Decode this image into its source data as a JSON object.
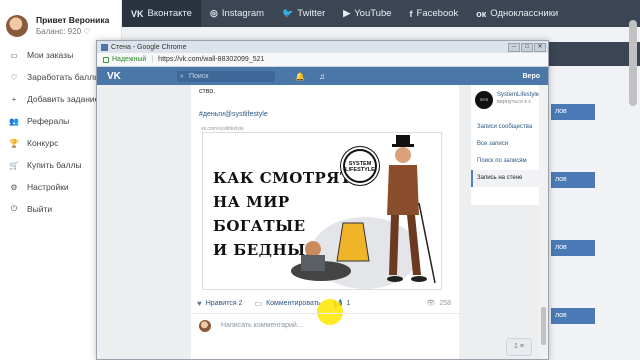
{
  "profile": {
    "name": "Привет Вероника",
    "balance": "Баланс: 920 ♡"
  },
  "menu": [
    {
      "icon": "cart-icon",
      "glyph": "▭",
      "label": "Мои заказы"
    },
    {
      "icon": "heart-icon",
      "glyph": "♡",
      "label": "Заработать баллы"
    },
    {
      "icon": "plus-icon",
      "glyph": "+",
      "label": "Добавить задание"
    },
    {
      "icon": "users-icon",
      "glyph": "👥",
      "label": "Рефералы"
    },
    {
      "icon": "trophy-icon",
      "glyph": "🏆",
      "label": "Конкурс"
    },
    {
      "icon": "cart-buy-icon",
      "glyph": "🛒",
      "label": "Купить баллы"
    },
    {
      "icon": "gear-icon",
      "glyph": "⚙",
      "label": "Настройки"
    },
    {
      "icon": "power-icon",
      "glyph": "⏻",
      "label": "Выйти"
    }
  ],
  "topnav": [
    {
      "icon": "vk-icon",
      "glyph": "VK",
      "label": "Вконтакте",
      "active": true
    },
    {
      "icon": "instagram-icon",
      "glyph": "◎",
      "label": "Instagram",
      "active": false
    },
    {
      "icon": "twitter-icon",
      "glyph": "🐦",
      "label": "Twitter",
      "active": false
    },
    {
      "icon": "youtube-icon",
      "glyph": "▶",
      "label": "YouTube",
      "active": false
    },
    {
      "icon": "facebook-icon",
      "glyph": "f",
      "label": "Facebook",
      "active": false
    },
    {
      "icon": "odnoklassniki-icon",
      "glyph": "ок",
      "label": "Одноклассники",
      "active": false
    }
  ],
  "background": {
    "button_label": "лов"
  },
  "chrome": {
    "title": "Стена - Google Chrome",
    "secure_label": "Надежный",
    "url": "https://vk.com/wall-88302099_521"
  },
  "vk": {
    "logo": "VK",
    "search_placeholder": "Поиск",
    "user_short": "Веро"
  },
  "post": {
    "text_fragment": "ство.",
    "hashtag": "#деньги@systlifestyle",
    "link": "vk.com/systlifestyle",
    "image_lines": [
      "КАК СМОТРЯТ",
      "НА МИР",
      "БОГАТЫЕ",
      "И БЕДНЫЕ"
    ],
    "logo_text_1": "SYSTEM",
    "logo_text_2": "LIFESTYLE",
    "like_label": "Нравится",
    "like_count": "2",
    "comment_label": "Комментировать",
    "share_count": "1",
    "views": "258",
    "comment_placeholder": "Написать комментарий..."
  },
  "sidebar_right": {
    "group_name": "SystemLifestyle",
    "group_sub": "вернуться к с",
    "items": [
      "Записи сообщества",
      "Все записи",
      "Поиск по записям",
      "Запись на стене"
    ],
    "active_index": 3
  },
  "chat_button": "1 ≡"
}
